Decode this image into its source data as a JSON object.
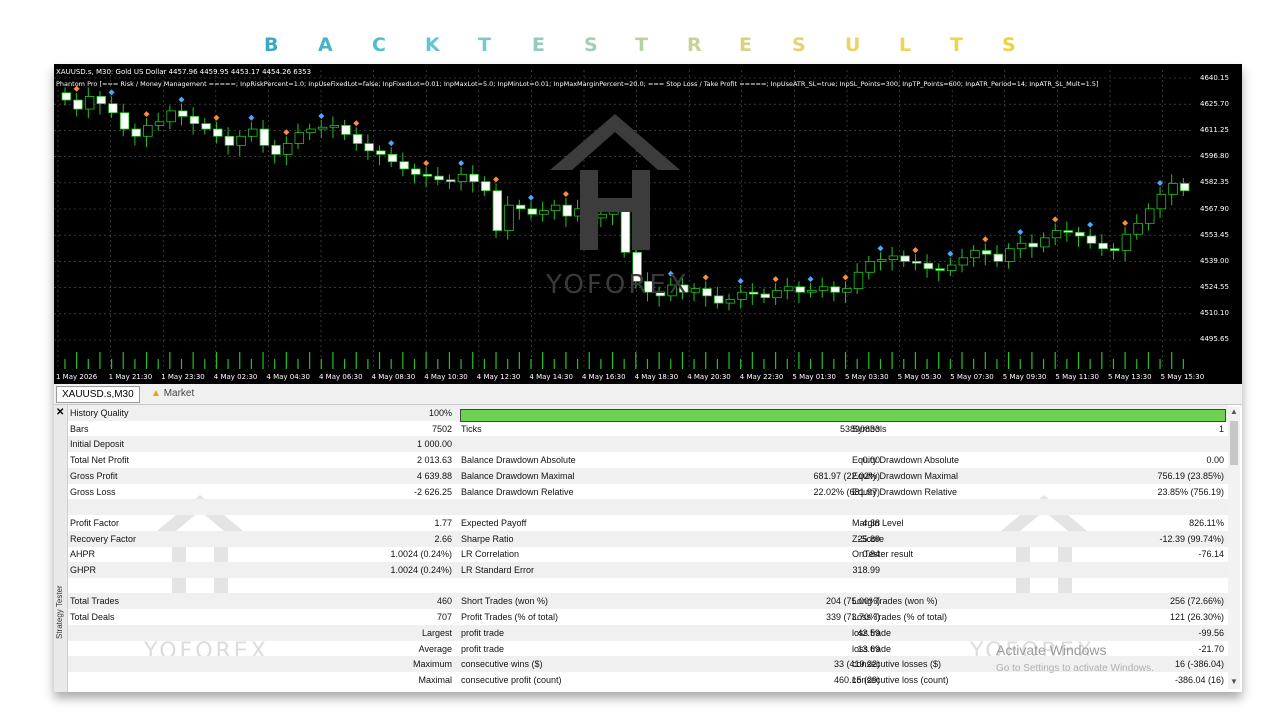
{
  "title_letters": [
    {
      "ch": "B",
      "color": "#3aa9c6"
    },
    {
      "ch": "A",
      "color": "#46b3cc"
    },
    {
      "ch": "C",
      "color": "#52bdd0"
    },
    {
      "ch": "K",
      "color": "#5ec6d2"
    },
    {
      "ch": "T",
      "color": "#7cc8c8"
    },
    {
      "ch": "E",
      "color": "#92cbc0"
    },
    {
      "ch": "S",
      "color": "#a4cdb4"
    },
    {
      "ch": "T",
      "color": "#b8d0a4"
    },
    {
      "ch": "R",
      "color": "#c8d294"
    },
    {
      "ch": "E",
      "color": "#d6d484"
    },
    {
      "ch": "S",
      "color": "#e2d474"
    },
    {
      "ch": "U",
      "color": "#ead466"
    },
    {
      "ch": "L",
      "color": "#efd45a"
    },
    {
      "ch": "T",
      "color": "#f2d24c"
    },
    {
      "ch": "S",
      "color": "#f4cf3e"
    }
  ],
  "chart": {
    "header": "XAUUSD.s, M30:  Gold US Dollar  4457.96  4459.95  4453.17  4454.26   6353",
    "params": "Phantom Pro [=== Risk / Money Management =====; InpRiskPercent=1.0; InpUseFixedLot=false; InpFixedLot=0.01; InpMaxLot=5.0; InpMinLot=0.01; InpMaxMarginPercent=20.0; === Stop Loss / Take Profit =====; InpUseATR_SL=true; InpSL_Points=300; InpTP_Points=600; InpATR_Period=14; InpATR_SL_Mult=1.5] ",
    "prices": [
      "4640.15",
      "4625.70",
      "4611.25",
      "4596.80",
      "4582.35",
      "4567.90",
      "4553.45",
      "4539.00",
      "4524.55",
      "4510.10",
      "4495.65"
    ],
    "times": [
      "1 May 2026",
      "1 May 21:30",
      "1 May 23:30",
      "4 May 02:30",
      "4 May 04:30",
      "4 May 06:30",
      "4 May 08:30",
      "4 May 10:30",
      "4 May 12:30",
      "4 May 14:30",
      "4 May 16:30",
      "4 May 18:30",
      "4 May 20:30",
      "4 May 22:30",
      "5 May 01:30",
      "5 May 03:30",
      "5 May 05:30",
      "5 May 07:30",
      "5 May 09:30",
      "5 May 11:30",
      "5 May 13:30",
      "5 May 15:30"
    ],
    "watermark": "YOFOREX",
    "closes": [
      4628,
      4623,
      4630,
      4626,
      4621,
      4612,
      4608,
      4614,
      4616,
      4622,
      4619,
      4615,
      4612,
      4608,
      4603,
      4608,
      4612,
      4603,
      4598,
      4604,
      4610,
      4612,
      4613,
      4614,
      4609,
      4604,
      4600,
      4598,
      4594,
      4590,
      4587,
      4586,
      4584,
      4583,
      4587,
      4583,
      4578,
      4556,
      4570,
      4568,
      4565,
      4567,
      4570,
      4564,
      4568,
      4563,
      4565,
      4568,
      4544,
      4528,
      4522,
      4520,
      4526,
      4522,
      4524,
      4520,
      4516,
      4518,
      4522,
      4521,
      4519,
      4523,
      4525,
      4522,
      4523,
      4525,
      4522,
      4524,
      4533,
      4539,
      4540,
      4542,
      4539,
      4538,
      4535,
      4534,
      4537,
      4541,
      4545,
      4543,
      4539,
      4546,
      4549,
      4547,
      4552,
      4556,
      4555,
      4553,
      4549,
      4546,
      4545,
      4554,
      4560,
      4568,
      4576,
      4582,
      4578
    ]
  },
  "tabs": {
    "symbol": "XAUUSD.s,M30",
    "market": "Market"
  },
  "side_label": "Strategy Tester",
  "watermark": "YOFOREX",
  "activate": {
    "line1": "Activate Windows",
    "line2": "Go to Settings to activate Windows."
  },
  "rows": [
    [
      "History Quality",
      "100%",
      "",
      "",
      "",
      ""
    ],
    [
      "Bars",
      "7502",
      "Ticks",
      "53890833",
      "Symbols",
      "1"
    ],
    [
      "Initial Deposit",
      "1 000.00",
      "",
      "",
      "",
      ""
    ],
    [
      "Total Net Profit",
      "2 013.63",
      "Balance Drawdown Absolute",
      "0.00",
      "Equity Drawdown Absolute",
      "0.00"
    ],
    [
      "Gross Profit",
      "4 639.88",
      "Balance Drawdown Maximal",
      "681.97 (22.02%)",
      "Equity Drawdown Maximal",
      "756.19 (23.85%)"
    ],
    [
      "Gross Loss",
      "-2 626.25",
      "Balance Drawdown Relative",
      "22.02% (681.97)",
      "Equity Drawdown Relative",
      "23.85% (756.19)"
    ],
    [
      "",
      "",
      "",
      "",
      "",
      ""
    ],
    [
      "Profit Factor",
      "1.77",
      "Expected Payoff",
      "4.38",
      "Margin Level",
      "826.11%"
    ],
    [
      "Recovery Factor",
      "2.66",
      "Sharpe Ratio",
      "25.89",
      "Z-Score",
      "-12.39 (99.74%)"
    ],
    [
      "AHPR",
      "1.0024 (0.24%)",
      "LR Correlation",
      "0.84",
      "OnTester result",
      "-76.14"
    ],
    [
      "GHPR",
      "1.0024 (0.24%)",
      "LR Standard Error",
      "318.99",
      "",
      ""
    ],
    [
      "",
      "",
      "",
      "",
      "",
      ""
    ],
    [
      "Total Trades",
      "460",
      "Short Trades (won %)",
      "204 (75.00%)",
      "Long Trades (won %)",
      "256 (72.66%)"
    ],
    [
      "Total Deals",
      "707",
      "Profit Trades (% of total)",
      "339 (73.70%)",
      "Loss Trades (% of total)",
      "121 (26.30%)"
    ],
    [
      "",
      "Largest",
      "profit trade",
      "42.59",
      "loss trade",
      "-99.56"
    ],
    [
      "",
      "Average",
      "profit trade",
      "13.69",
      "loss trade",
      "-21.70"
    ],
    [
      "",
      "Maximum",
      "consecutive wins ($)",
      "33 (419.22)",
      "consecutive losses ($)",
      "16 (-386.04)"
    ],
    [
      "",
      "Maximal",
      "consecutive profit (count)",
      "460.15 (29)",
      "consecutive loss (count)",
      "-386.04 (16)"
    ]
  ]
}
